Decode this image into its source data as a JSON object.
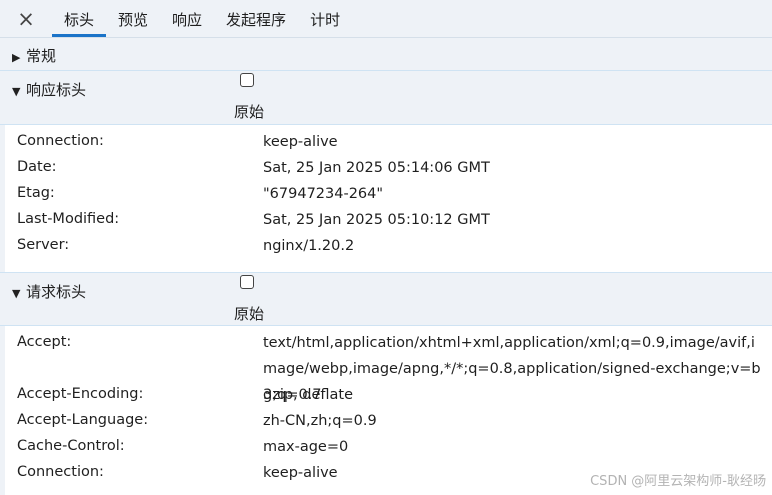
{
  "tabs": {
    "close_icon": "×",
    "items": [
      "标头",
      "预览",
      "响应",
      "发起程序",
      "计时"
    ],
    "active_index": 0
  },
  "general": {
    "arrow": "▶",
    "label": "常规"
  },
  "response_headers": {
    "arrow": "▼",
    "title": "响应标头",
    "raw_label": "原始",
    "raw_checked": false,
    "rows": [
      {
        "key": "Connection:",
        "value": "keep-alive"
      },
      {
        "key": "Date:",
        "value": "Sat, 25 Jan 2025 05:14:06 GMT"
      },
      {
        "key": "Etag:",
        "value": "\"67947234-264\""
      },
      {
        "key": "Last-Modified:",
        "value": "Sat, 25 Jan 2025 05:10:12 GMT"
      },
      {
        "key": "Server:",
        "value": "nginx/1.20.2"
      }
    ]
  },
  "request_headers": {
    "arrow": "▼",
    "title": "请求标头",
    "raw_label": "原始",
    "raw_checked": false,
    "rows": [
      {
        "key": "Accept:",
        "value": "text/html,application/xhtml+xml,application/xml;q=0.9,image/avif,image/webp,image/apng,*/*;q=0.8,application/signed-exchange;v=b3;q=0.7"
      },
      {
        "key": "Accept-Encoding:",
        "value": "gzip, deflate"
      },
      {
        "key": "Accept-Language:",
        "value": "zh-CN,zh;q=0.9"
      },
      {
        "key": "Cache-Control:",
        "value": "max-age=0"
      },
      {
        "key": "Connection:",
        "value": "keep-alive"
      }
    ]
  },
  "watermark": "CSDN @阿里云架构师-耿经旸"
}
